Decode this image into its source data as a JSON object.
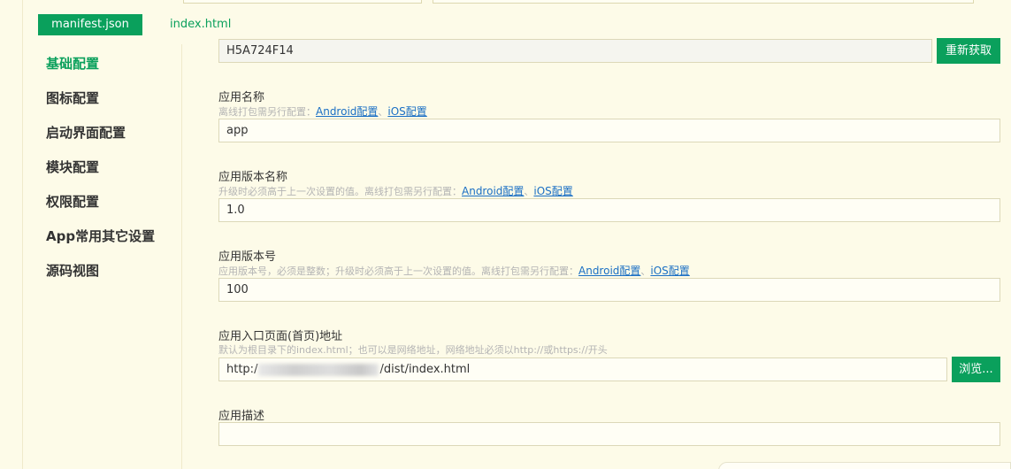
{
  "tabs": {
    "manifest": "manifest.json",
    "index": "index.html"
  },
  "sidebar": {
    "items": [
      {
        "label": "基础配置",
        "active": true
      },
      {
        "label": "图标配置"
      },
      {
        "label": "启动界面配置"
      },
      {
        "label": "模块配置"
      },
      {
        "label": "权限配置"
      },
      {
        "label": "App常用其它设置"
      },
      {
        "label": "源码视图"
      }
    ]
  },
  "form": {
    "appid": {
      "value": "H5A724F14",
      "button": "重新获取"
    },
    "app_name": {
      "label": "应用名称",
      "hint_prefix": "离线打包需另行配置：",
      "link_android": "Android配置",
      "link_sep": "、",
      "link_ios": "iOS配置",
      "value": "app"
    },
    "version_name": {
      "label": "应用版本名称",
      "hint_prefix": "升级时必须高于上一次设置的值。离线打包需另行配置：",
      "link_android": "Android配置",
      "link_sep": "、",
      "link_ios": "iOS配置",
      "value": "1.0"
    },
    "version_code": {
      "label": "应用版本号",
      "hint_prefix": "应用版本号，必须是整数；升级时必须高于上一次设置的值。离线打包需另行配置：",
      "link_android": "Android配置",
      "link_sep": "、",
      "link_ios": "iOS配置",
      "value": "100"
    },
    "entry": {
      "label": "应用入口页面(首页)地址",
      "hint": "默认为根目录下的index.html；也可以是网络地址，网络地址必须以http://或https://开头",
      "value_prefix": "http:/",
      "value_suffix": "/dist/index.html",
      "button": "浏览..."
    },
    "description": {
      "label": "应用描述",
      "value": ""
    }
  },
  "colors": {
    "accent": "#0aa05c",
    "background": "#fdfbe8",
    "link": "#1a6fc4"
  }
}
